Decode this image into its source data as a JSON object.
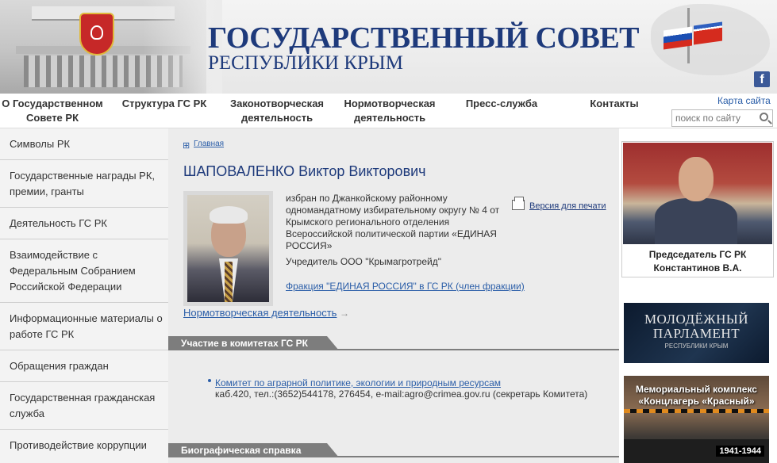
{
  "header": {
    "title_line1": "ГОСУДАРСТВЕННЫЙ СОВЕТ",
    "title_line2": "РЕСПУБЛИКИ КРЫМ",
    "facebook_glyph": "f"
  },
  "nav": {
    "items": [
      {
        "line1": "О Государственном",
        "line2": "Совете РК"
      },
      {
        "line1": "Структура ГС РК",
        "line2": ""
      },
      {
        "line1": "Законотворческая",
        "line2": "деятельность"
      },
      {
        "line1": "Нормотворческая",
        "line2": "деятельность"
      },
      {
        "line1": "Пресс-служба",
        "line2": ""
      },
      {
        "line1": "Контакты",
        "line2": ""
      }
    ],
    "sitemap": "Карта сайта",
    "search_placeholder": "поиск по сайту"
  },
  "sidebar": {
    "items": [
      {
        "label": "Символы РК"
      },
      {
        "label": "Государственные награды РК, премии, гранты"
      },
      {
        "label": "Деятельность ГС РК"
      },
      {
        "label": "Взаимодействие с Федеральным Собранием Российской Федерации"
      },
      {
        "label": "Информационные материалы о работе ГС РК"
      },
      {
        "label": "Обращения граждан"
      },
      {
        "label": "Государственная гражданская служба"
      },
      {
        "label": "Противодействие коррупции"
      }
    ]
  },
  "main": {
    "breadcrumb": "Главная",
    "deputy_name": "ШАПОВАЛЕНКО Виктор Викторович",
    "elected_text": "избран по Джанкойскому районному одномандатному избирательному округу № 4 от Крымского регионального отделения Всероссийской политической партии «ЕДИНАЯ РОССИЯ»",
    "founder_text": "Учредитель ООО \"Крымагротрейд\"",
    "faction_link": "Фракция \"ЕДИНАЯ РОССИЯ\" в ГС РК (член фракции)",
    "print_link": "Версия для печати",
    "normo_link": "Нормотворческая деятельность",
    "normo_arrow": "→",
    "committees_header": "Участие в комитетах ГС РК",
    "committee_link": "Комитет по аграрной политике, экологии и природным ресурсам",
    "committee_contact": "каб.420, тел.:(3652)544178, 276454, e-mail:agro@crimea.gov.ru (секретарь Комитета)",
    "bio_header": "Биографическая справка"
  },
  "right": {
    "chairman_caption_line1": "Председатель ГС РК",
    "chairman_caption_line2": "Константинов В.А.",
    "banner1_line1": "МОЛОДЁЖНЫЙ",
    "banner1_line2": "ПАРЛАМЕНТ",
    "banner1_line3": "РЕСПУБЛИКИ КРЫМ",
    "banner2_line1": "Мемориальный комплекс",
    "banner2_line2": "«Концлагерь «Красный»",
    "banner2_years": "1941-1944"
  }
}
